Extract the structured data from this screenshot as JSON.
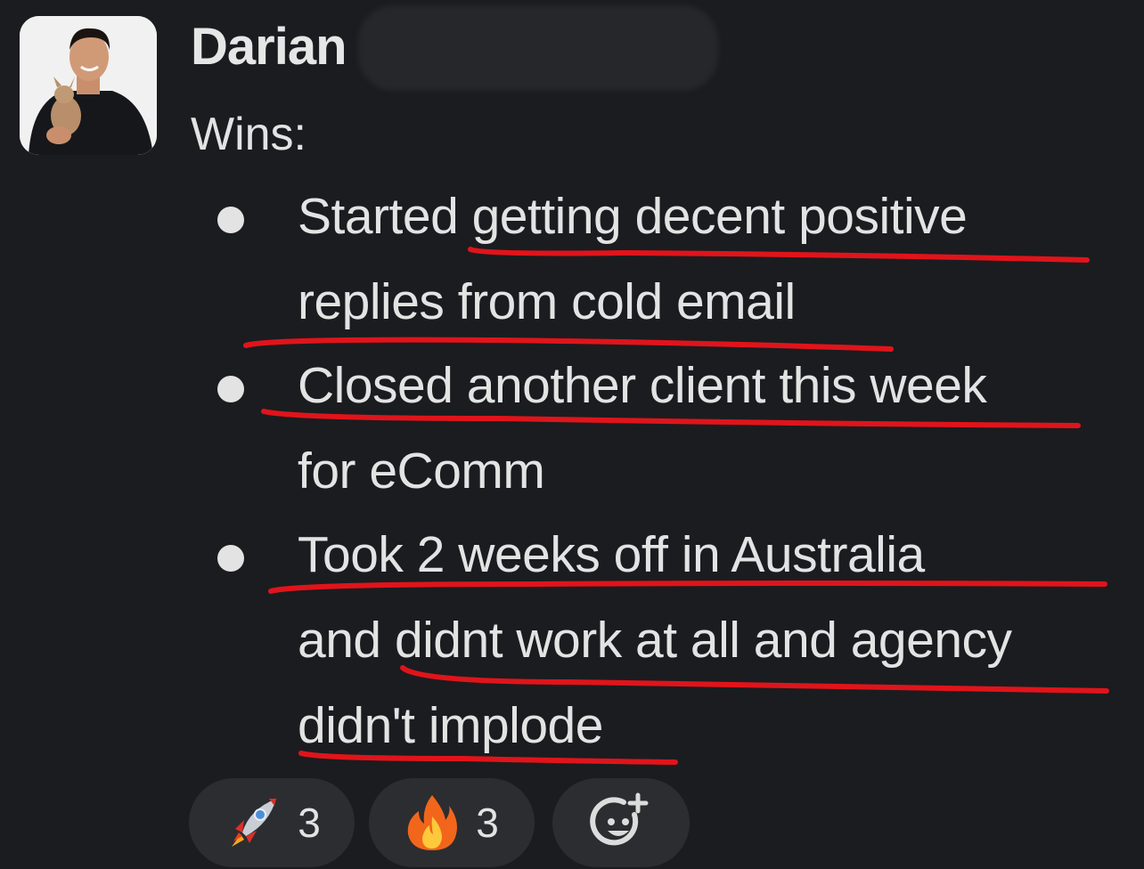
{
  "message": {
    "author": "Darian",
    "heading": "Wins:",
    "bullets": [
      {
        "lines": [
          "Started getting decent positive",
          "replies from cold email"
        ]
      },
      {
        "lines": [
          "Closed another client this week",
          "for eComm"
        ]
      },
      {
        "lines": [
          "Took 2 weeks off in Australia",
          "and didnt work at all and agency",
          "didn't implode"
        ]
      }
    ]
  },
  "reactions": [
    {
      "icon": "rocket-icon",
      "count": "3"
    },
    {
      "icon": "fire-icon",
      "count": "3"
    },
    {
      "icon": "add-reaction-icon"
    }
  ],
  "colors": {
    "background": "#1b1c1f",
    "text": "#e3e3e3",
    "underline": "#e0141b",
    "reaction_pill": "#2c2d31"
  }
}
